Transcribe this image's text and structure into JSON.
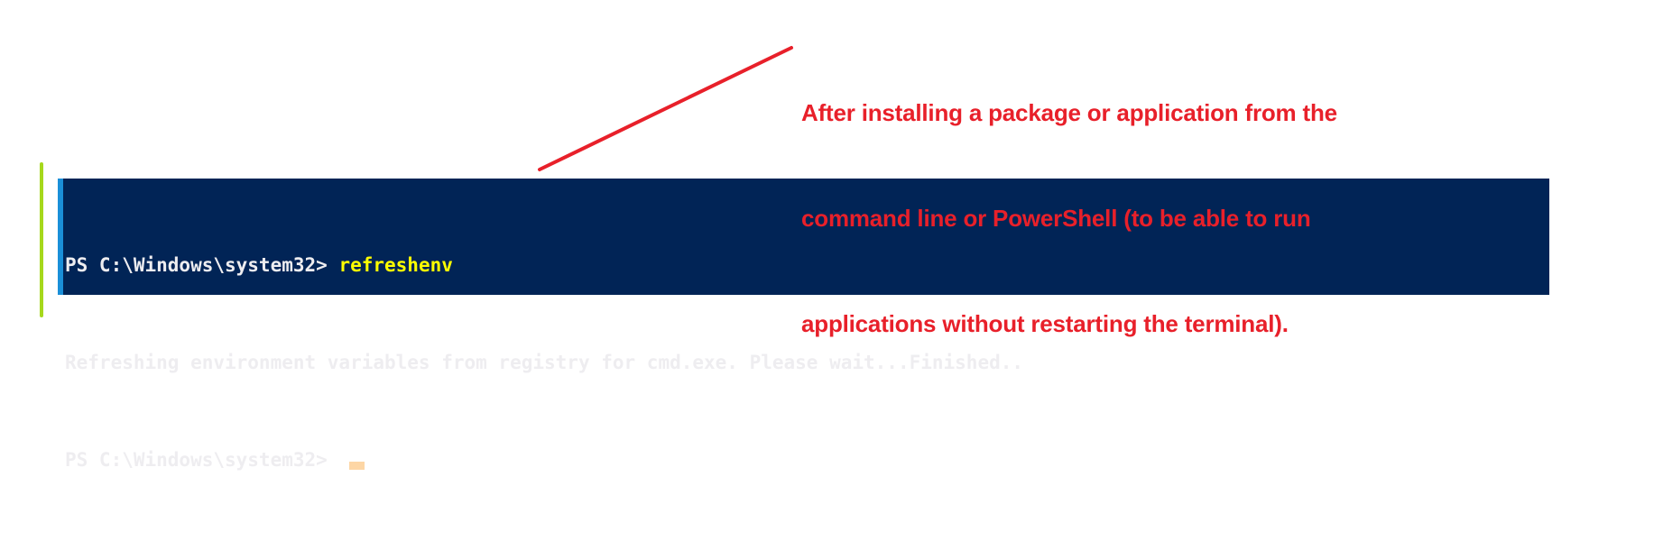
{
  "terminal": {
    "lines": [
      {
        "prompt": "PS C:\\Windows\\system32> ",
        "command": "refreshenv"
      },
      {
        "output": "Refreshing environment variables from registry for cmd.exe. Please wait...Finished.."
      },
      {
        "prompt": "PS C:\\Windows\\system32> ",
        "command": ""
      }
    ]
  },
  "annotation": {
    "lines": [
      "After installing a package or application from the",
      "command line or PowerShell (to be able to run",
      "applications without restarting the terminal)."
    ],
    "color": "#e8202a"
  },
  "colors": {
    "terminal_bg": "#012456",
    "command": "#ffff00",
    "cursor": "#fdd6a5"
  }
}
